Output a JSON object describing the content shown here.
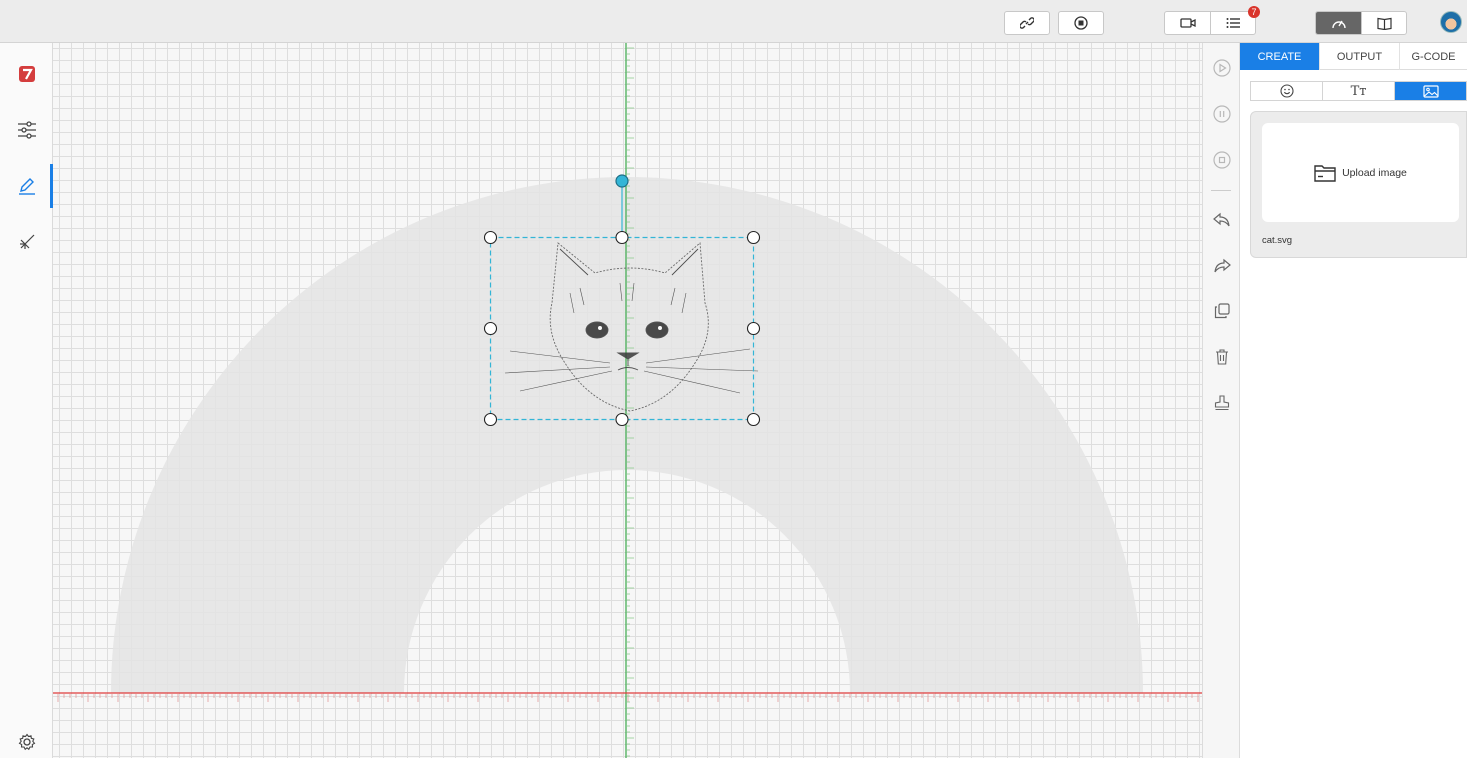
{
  "topbar": {
    "icons": [
      "link-icon",
      "stop-circle-icon",
      "camera-icon",
      "list-icon",
      "speed-gauge-icon",
      "book-icon"
    ],
    "notification_count": "7",
    "colors": {
      "active_mode": "#666666",
      "badge": "#d9342b"
    }
  },
  "leftnav": {
    "items": [
      "app-logo-icon",
      "sliders-icon",
      "pen-icon",
      "laser-icon"
    ],
    "active_item": "pen-icon",
    "footer_icon": "settings-gear-icon"
  },
  "canvas": {
    "image_name": "cat.svg",
    "image_subject": "sketch-cat-face",
    "colors": {
      "x_axis": "#e03c3c",
      "y_axis": "#3aa84a",
      "selection": "#33b5d6",
      "work_area": "#e4e4e4"
    }
  },
  "tools": [
    "play-icon",
    "pause-icon",
    "stop-icon",
    "undo-icon",
    "redo-icon",
    "duplicate-icon",
    "trash-icon",
    "stamp-icon"
  ],
  "panel": {
    "tabs": [
      {
        "label": "CREATE",
        "active": true
      },
      {
        "label": "OUTPUT",
        "active": false
      },
      {
        "label": "G-CODE",
        "active": false
      }
    ],
    "subtabs": [
      {
        "icon": "smiley-icon",
        "label": "",
        "active": false
      },
      {
        "icon": "text-icon",
        "label": "Tт",
        "active": false
      },
      {
        "icon": "image-icon",
        "label": "",
        "active": true
      }
    ],
    "upload_label": "Upload image",
    "file_name": "cat.svg",
    "accent": "#1a7fe6"
  }
}
